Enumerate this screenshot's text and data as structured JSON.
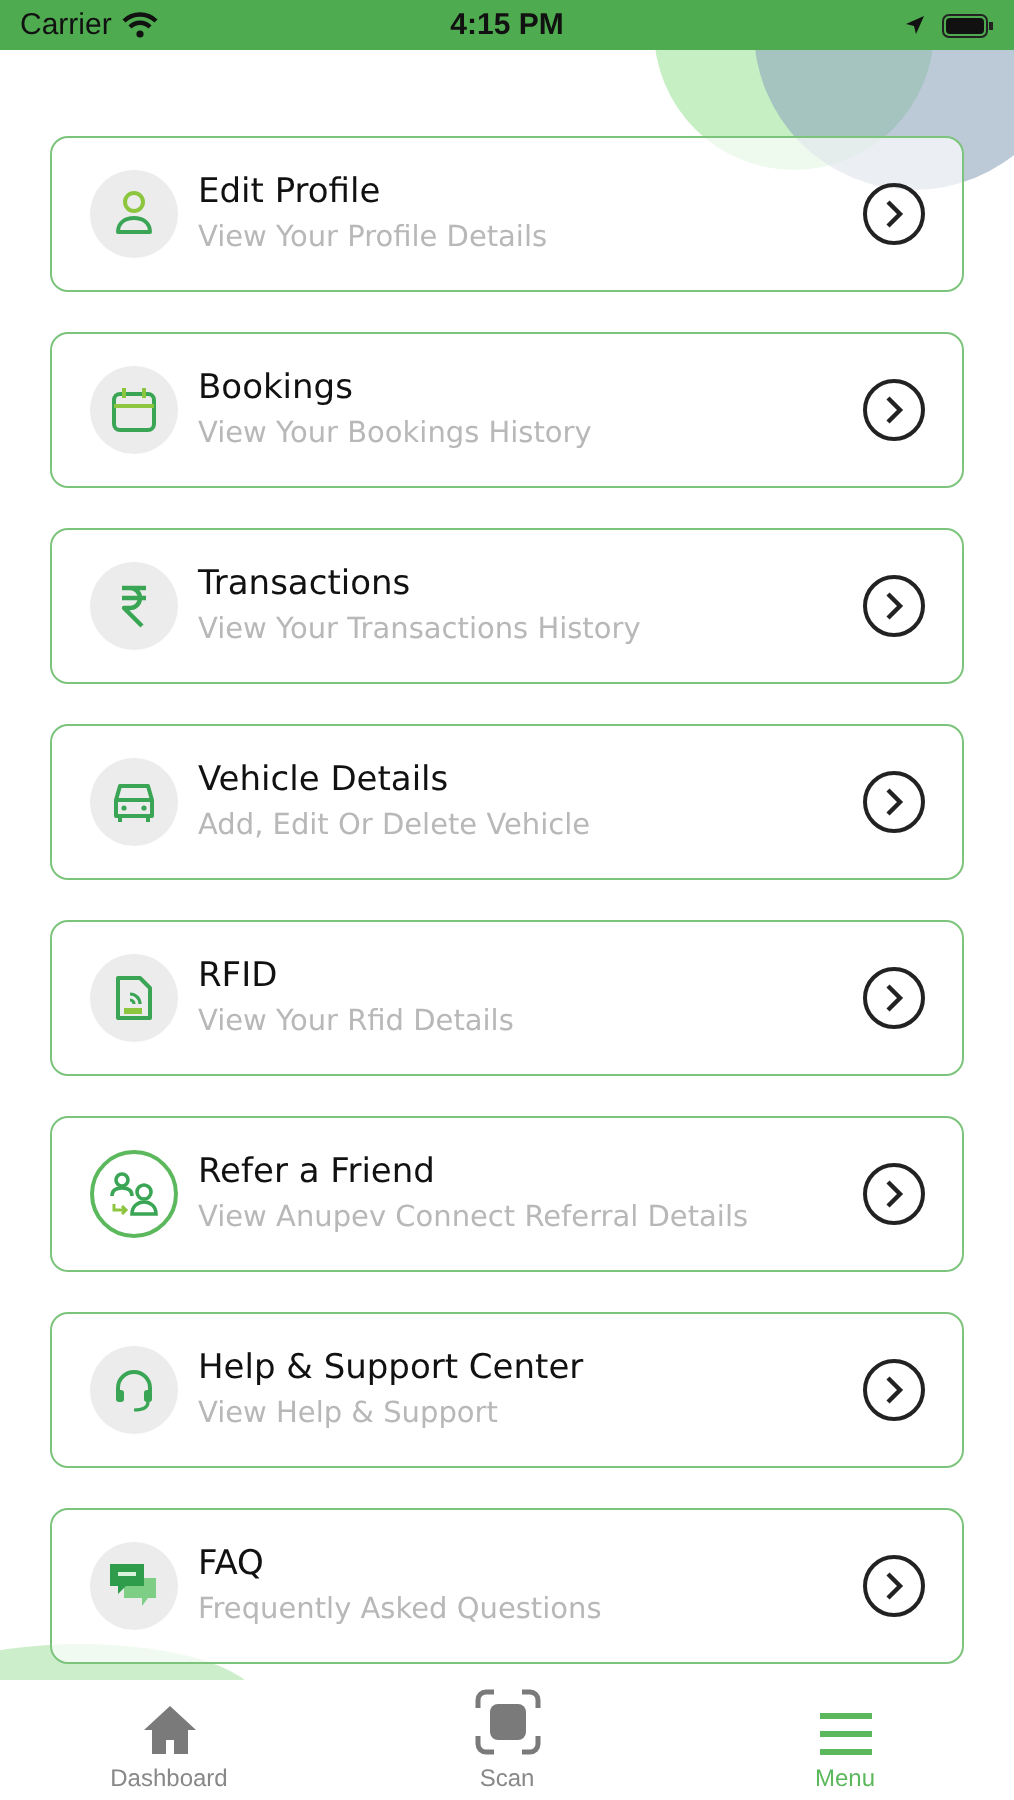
{
  "status_bar": {
    "carrier": "Carrier",
    "time": "4:15 PM"
  },
  "menu_items": [
    {
      "kind": "profile",
      "title": "Edit Profile",
      "subtitle": "View Your Profile Details"
    },
    {
      "kind": "calendar",
      "title": "Bookings",
      "subtitle": "View Your Bookings History"
    },
    {
      "kind": "rupee",
      "title": "Transactions",
      "subtitle": "View Your Transactions History"
    },
    {
      "kind": "car",
      "title": "Vehicle Details",
      "subtitle": "Add, Edit Or Delete Vehicle"
    },
    {
      "kind": "rfid",
      "title": "RFID",
      "subtitle": "View Your Rfid Details"
    },
    {
      "kind": "refer",
      "title": "Refer a Friend",
      "subtitle": "View Anupev Connect Referral Details"
    },
    {
      "kind": "headset",
      "title": "Help & Support Center",
      "subtitle": "View Help & Support"
    },
    {
      "kind": "faq",
      "title": "FAQ",
      "subtitle": "Frequently Asked Questions"
    }
  ],
  "tab_bar": [
    {
      "kind": "home",
      "label": "Dashboard",
      "selected": false
    },
    {
      "kind": "scan",
      "label": "Scan",
      "selected": false
    },
    {
      "kind": "menu",
      "label": "Menu",
      "selected": true
    }
  ]
}
